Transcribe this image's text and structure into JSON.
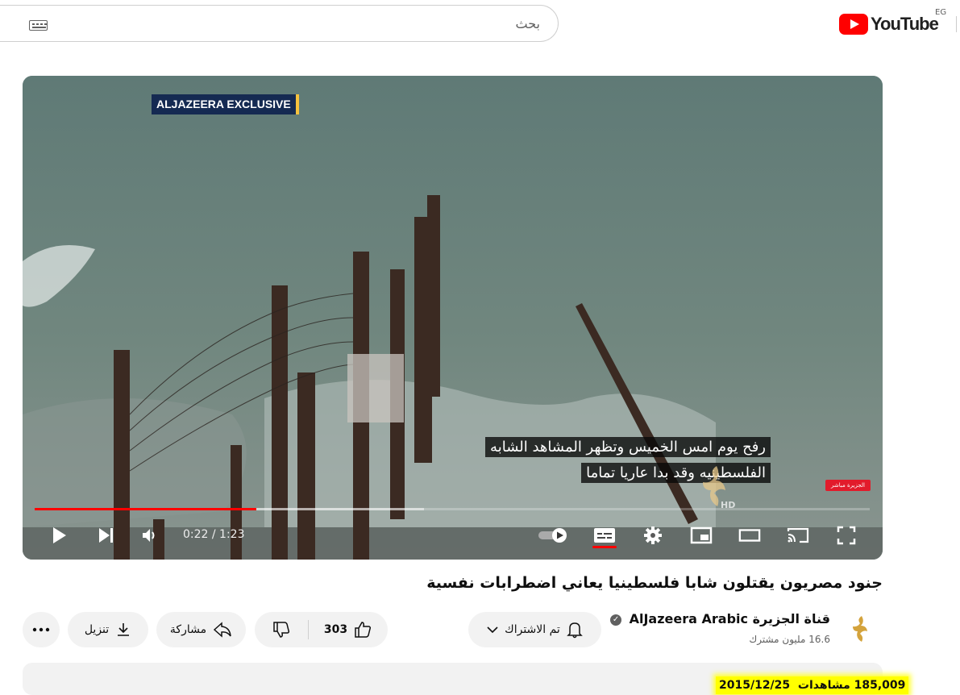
{
  "header": {
    "search_placeholder": "بحث",
    "logo_text": "YouTube",
    "region": "EG"
  },
  "player": {
    "badge": "ALJAZEERA EXCLUSIVE",
    "subtitle": "رفح يوم امس الخميس وتظهر المشاهد الشابه الفلسطينيه وقد بدا عاريا تماما",
    "hd_label": "HD",
    "live_tag": "الجزيرة مباشر",
    "time": "0:22 / 1:23",
    "progress_played": 0.265,
    "progress_buffered": 0.466,
    "accent_color": "#ff0000"
  },
  "video": {
    "title": "جنود مصريون يقتلون شابا فلسطينيا يعاني اضطرابات نفسية"
  },
  "channel": {
    "name_arabic": "قناة الجزيرة",
    "name_latin": "AlJazeera Arabic",
    "subscribers": "16.6 مليون مشترك"
  },
  "actions": {
    "subscribe_label": "تم الاشتراك",
    "like_count": "303",
    "share_label": "مشاركة",
    "download_label": "تنزيل"
  },
  "description": {
    "views": "185,009 مشاهدات",
    "date": "2015/12/25"
  }
}
